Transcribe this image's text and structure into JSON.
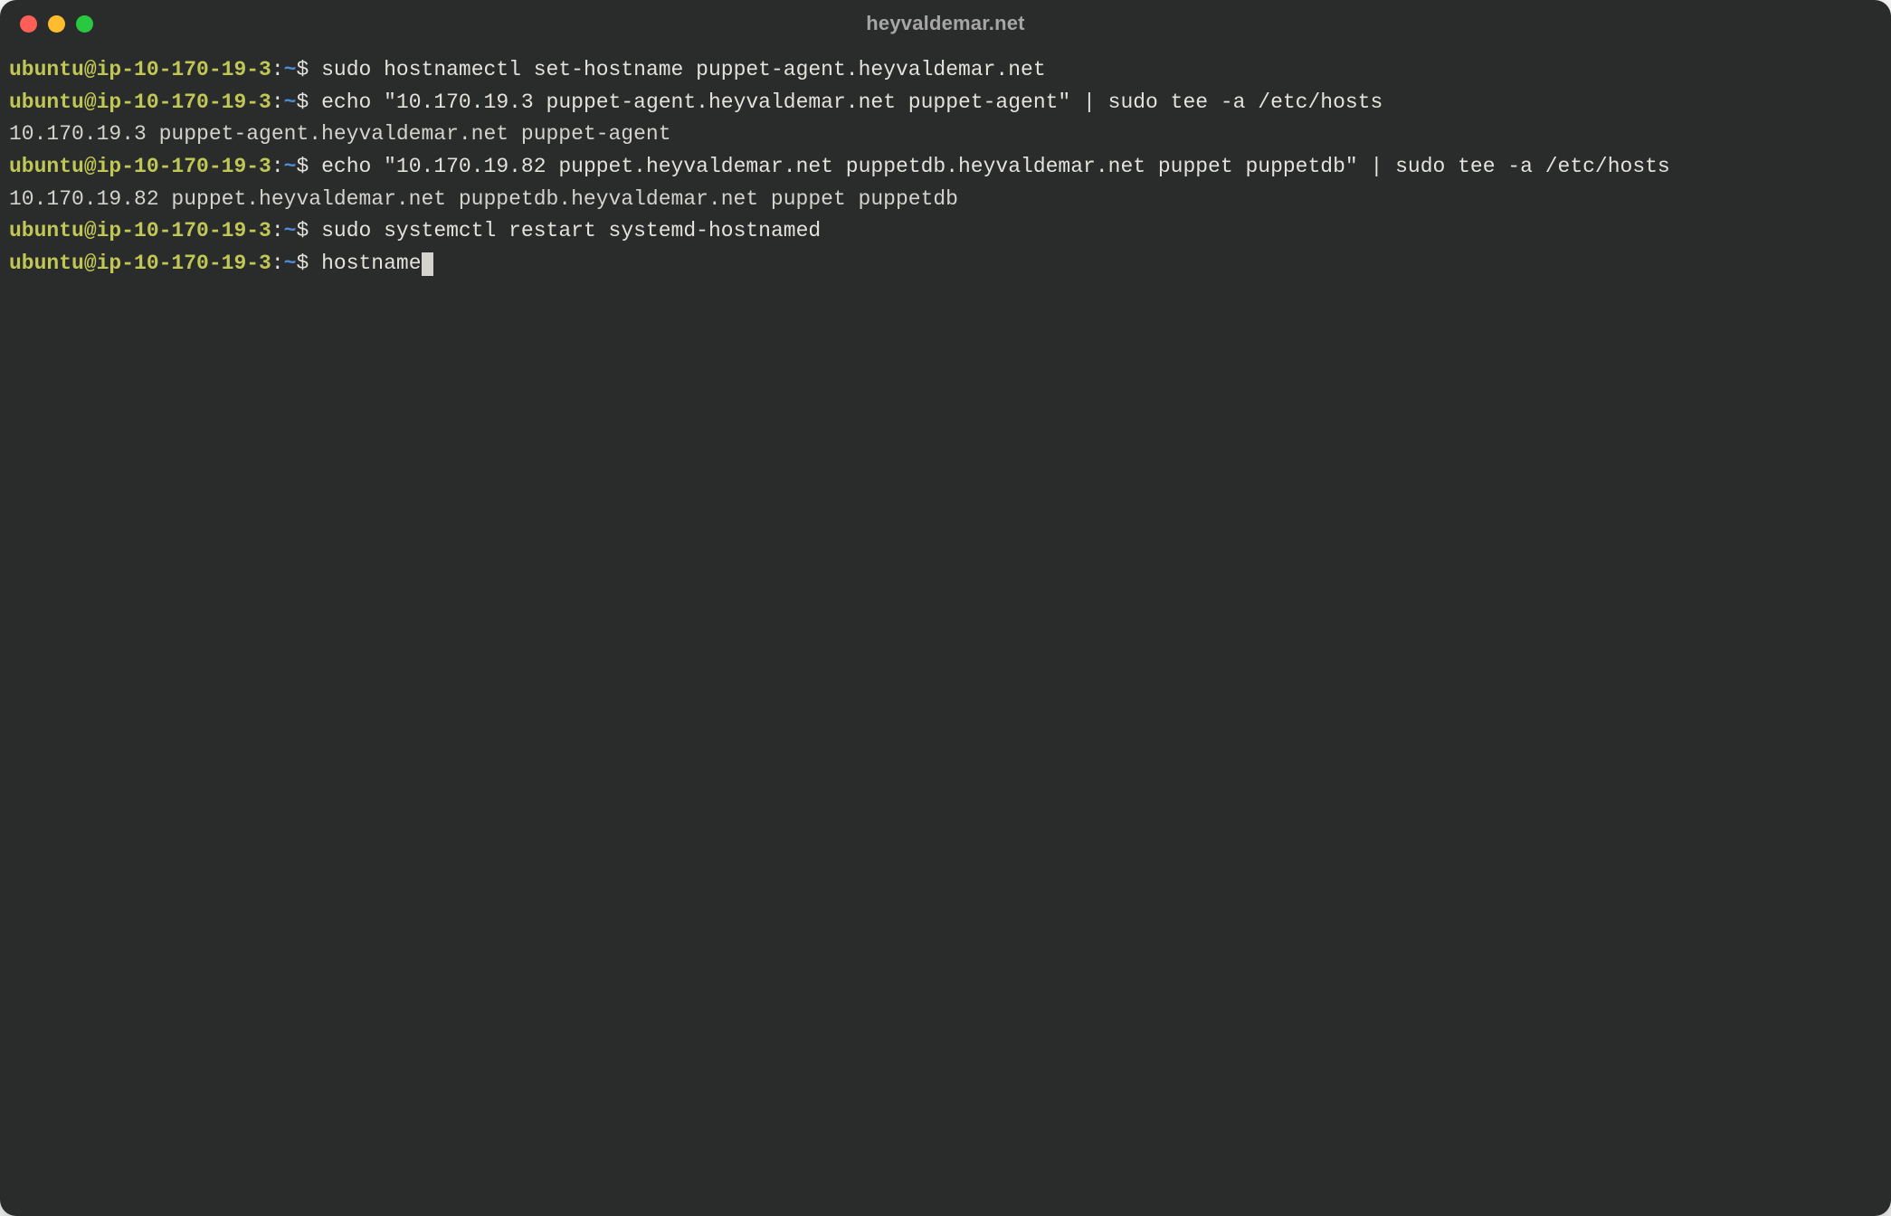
{
  "window": {
    "title": "heyvaldemar.net"
  },
  "prompt": {
    "user_host": "ubuntu@ip-10-170-19-3",
    "colon": ":",
    "path": "~",
    "dollar": "$"
  },
  "lines": [
    {
      "type": "prompt",
      "command": "sudo hostnamectl set-hostname puppet-agent.heyvaldemar.net"
    },
    {
      "type": "prompt",
      "command": "echo \"10.170.19.3 puppet-agent.heyvaldemar.net puppet-agent\" | sudo tee -a /etc/hosts"
    },
    {
      "type": "output",
      "text": "10.170.19.3 puppet-agent.heyvaldemar.net puppet-agent"
    },
    {
      "type": "prompt",
      "command": "echo \"10.170.19.82 puppet.heyvaldemar.net puppetdb.heyvaldemar.net puppet puppetdb\" | sudo tee -a /etc/hosts"
    },
    {
      "type": "output",
      "text": "10.170.19.82 puppet.heyvaldemar.net puppetdb.heyvaldemar.net puppet puppetdb"
    },
    {
      "type": "prompt",
      "command": "sudo systemctl restart systemd-hostnamed"
    },
    {
      "type": "prompt",
      "command": "hostname",
      "cursor": true
    }
  ],
  "colors": {
    "bg": "#2a2b2b",
    "fg": "#e3e2dc",
    "prompt_user": "#c0c754",
    "prompt_path": "#4f8bd6",
    "traffic_close": "#ff5f57",
    "traffic_minimize": "#febc2e",
    "traffic_zoom": "#28c840"
  }
}
